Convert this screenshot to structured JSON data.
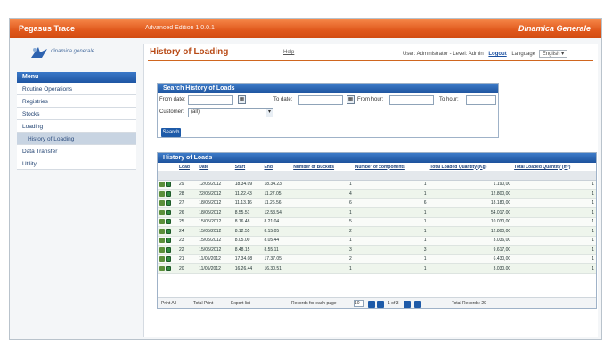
{
  "app": {
    "brand": "Pegasus Trace",
    "edition": "Advanced Edition 1.0.0.1",
    "company": "Dinamica Generale",
    "logo_text": "dinamica generale"
  },
  "header": {
    "page_title": "History of Loading",
    "help": "Help",
    "user_text": "User: Administrator - Level: Admin",
    "logout": "Logout",
    "language_label": "Language",
    "language_value": "English"
  },
  "sidebar": {
    "title": "Menu",
    "items": [
      {
        "label": "Routine Operations",
        "active": false,
        "sub": false
      },
      {
        "label": "Registries",
        "active": false,
        "sub": false
      },
      {
        "label": "Stocks",
        "active": false,
        "sub": false
      },
      {
        "label": "Loading",
        "active": false,
        "sub": false
      },
      {
        "label": "History of Loading",
        "active": true,
        "sub": true
      },
      {
        "label": "Data Transfer",
        "active": false,
        "sub": false
      },
      {
        "label": "Utility",
        "active": false,
        "sub": false
      }
    ]
  },
  "search": {
    "title": "Search History of Loads",
    "from_date": "From date:",
    "to_date": "To date:",
    "from_hour": "From hour:",
    "to_hour": "To hour:",
    "customer": "Customer:",
    "customer_value": "(all)",
    "button": "Search"
  },
  "history": {
    "title": "History of Loads",
    "columns": [
      "Load",
      "Date",
      "Start",
      "End",
      "Number of Buckets",
      "Number of components",
      "Total Loaded Quantity (Kg)",
      "Total Loaded Quantity (m³)"
    ],
    "rows": [
      [
        "29",
        "12/05/2012",
        "18.34.09",
        "18.34.23",
        "1",
        "1",
        "1.190,00",
        "1"
      ],
      [
        "28",
        "22/05/2012",
        "11.22.43",
        "11.27.05",
        "4",
        "1",
        "12.800,00",
        "1"
      ],
      [
        "27",
        "18/05/2012",
        "11.13.16",
        "11.26.56",
        "6",
        "6",
        "18.180,00",
        "1"
      ],
      [
        "26",
        "18/05/2012",
        "8.55.51",
        "12.53.54",
        "1",
        "1",
        "54.017,00",
        "1"
      ],
      [
        "25",
        "15/05/2012",
        "8.16.48",
        "8.21.04",
        "5",
        "1",
        "10.030,00",
        "1"
      ],
      [
        "24",
        "15/05/2012",
        "8.12.55",
        "8.15.05",
        "2",
        "1",
        "12.800,00",
        "1"
      ],
      [
        "23",
        "15/05/2012",
        "8.05.00",
        "8.05.44",
        "1",
        "1",
        "3.036,00",
        "1"
      ],
      [
        "22",
        "15/05/2012",
        "8.48.15",
        "8.55.11",
        "3",
        "3",
        "9.617,00",
        "1"
      ],
      [
        "21",
        "11/05/2012",
        "17.34.08",
        "17.37.05",
        "2",
        "1",
        "6.430,00",
        "1"
      ],
      [
        "20",
        "11/05/2012",
        "16.26.44",
        "16.30.51",
        "1",
        "1",
        "3.030,00",
        "1"
      ]
    ],
    "pager": {
      "print": "Print All",
      "total_print": "Total Print",
      "export": "Export list",
      "records_per_page": "Records for each page",
      "records_value": "10",
      "page_info": "1 of 3",
      "total_records": "Total Records: 29"
    }
  },
  "colors": {
    "accent": "#e0581c",
    "header_blue": "#1d529d",
    "title_orange": "#b84a16"
  }
}
